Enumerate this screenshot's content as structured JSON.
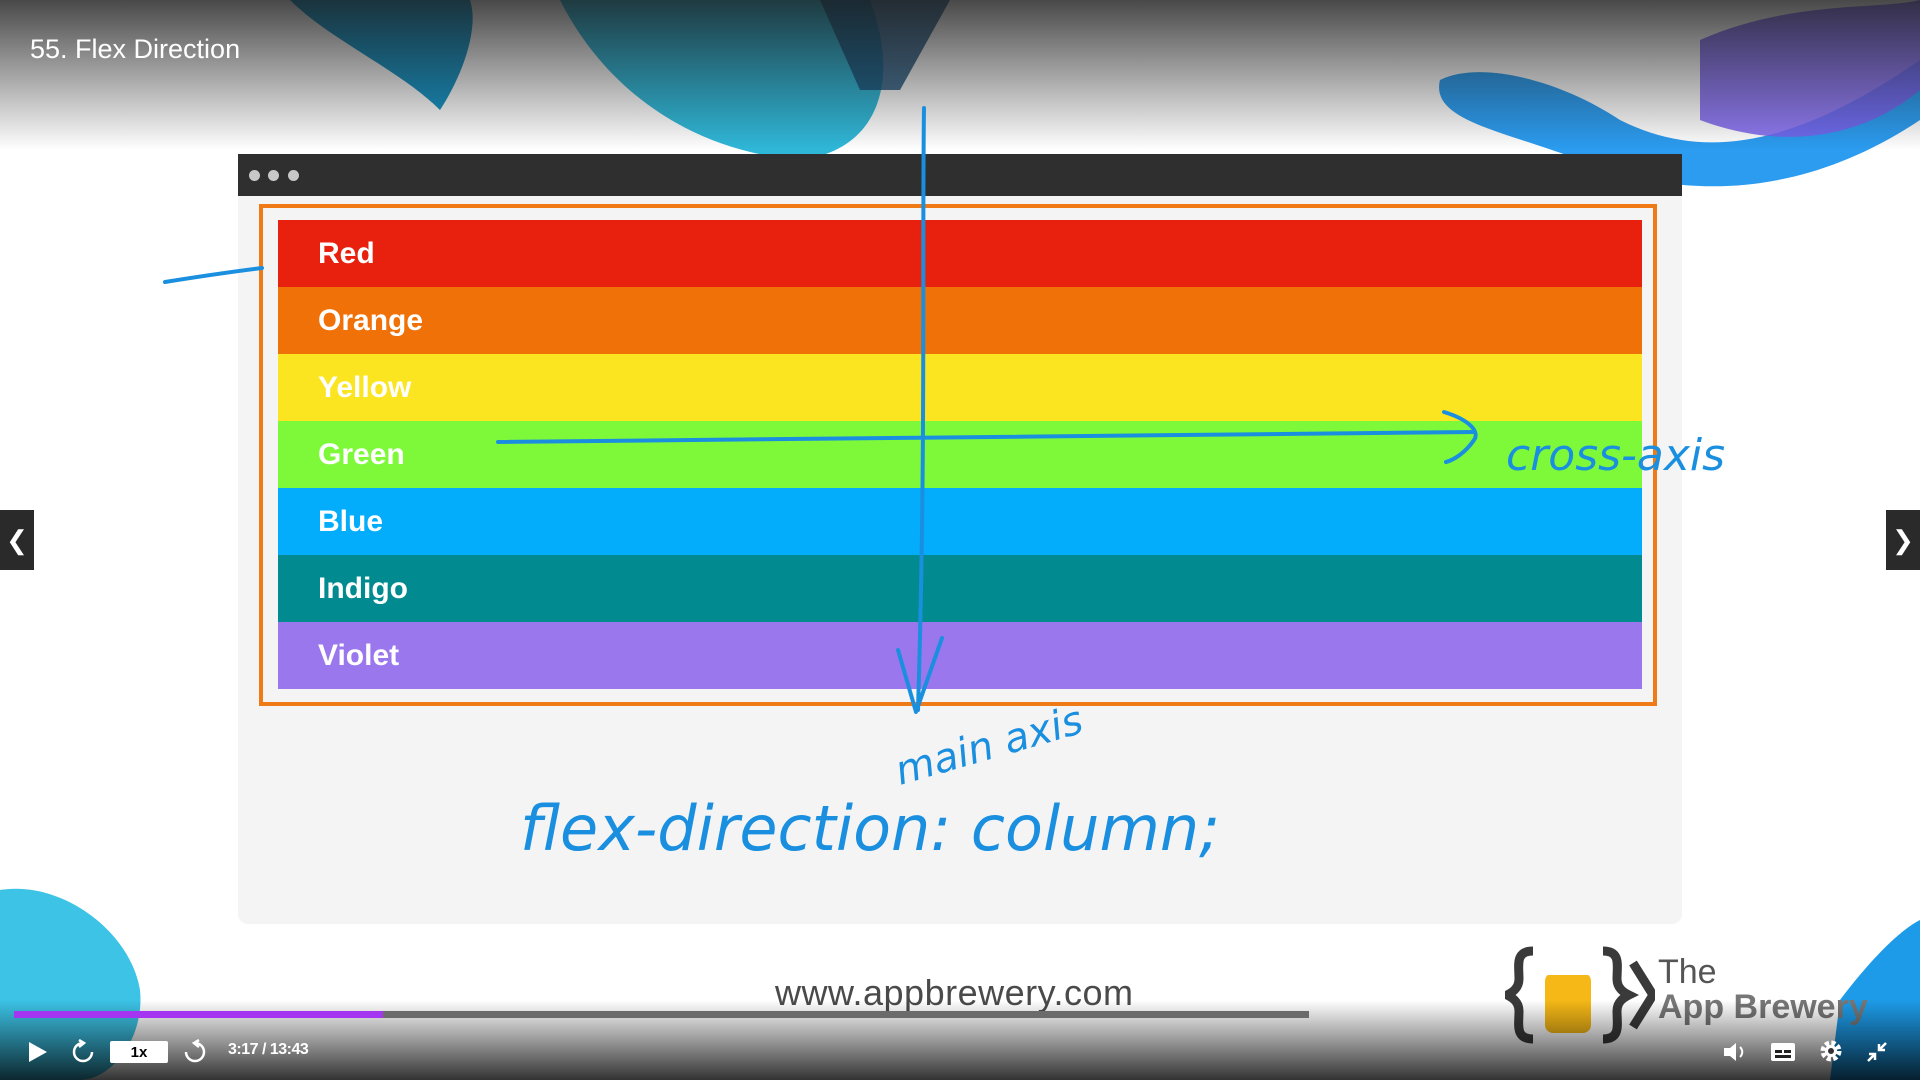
{
  "lecture": {
    "title": "55. Flex Direction"
  },
  "slide": {
    "rows": [
      {
        "label": "Red",
        "color": "#e8200e"
      },
      {
        "label": "Orange",
        "color": "#f07107"
      },
      {
        "label": "Yellow",
        "color": "#fae520"
      },
      {
        "label": "Green",
        "color": "#7ef93a"
      },
      {
        "label": "Blue",
        "color": "#03adfb"
      },
      {
        "label": "Indigo",
        "color": "#018b91"
      },
      {
        "label": "Violet",
        "color": "#9a77ec"
      }
    ],
    "container_border_color": "#f07a16",
    "annotations": {
      "cross_axis": "cross-axis",
      "main_axis": "main axis",
      "code": "flex-direction: column;",
      "ink_color": "#1a8fe0"
    },
    "website": "www.appbrewery.com",
    "logo": {
      "line1": "The",
      "line2": "App Brewery",
      "icon": "braces-beer-icon"
    }
  },
  "player": {
    "speed_label": "1x",
    "time": "3:17 / 13:43",
    "progress": 0.285,
    "accent_color": "#a435f0",
    "icons": {
      "play": "play-icon",
      "rewind": "rewind-icon",
      "forward": "forward-icon",
      "volume": "volume-icon",
      "captions": "captions-icon",
      "settings": "gear-icon",
      "exit_fullscreen": "exit-fullscreen-icon",
      "prev": "chevron-left-icon",
      "next": "chevron-right-icon"
    }
  }
}
